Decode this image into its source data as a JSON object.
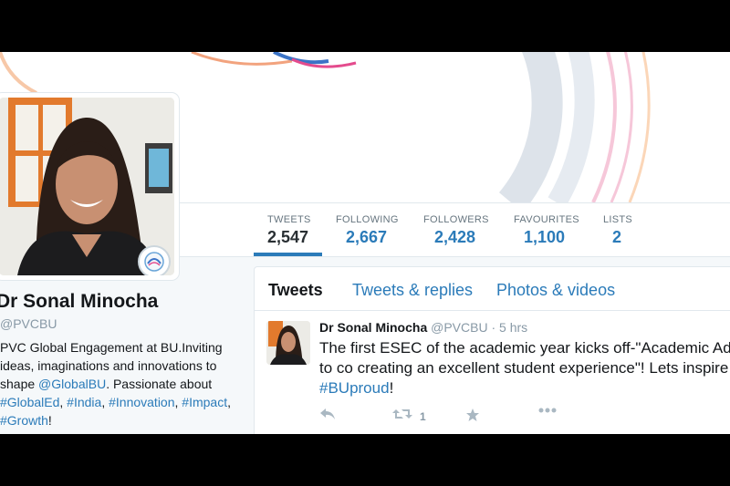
{
  "stats": [
    {
      "label": "TWEETS",
      "value": "2,547"
    },
    {
      "label": "FOLLOWING",
      "value": "2,667"
    },
    {
      "label": "FOLLOWERS",
      "value": "2,428"
    },
    {
      "label": "FAVOURITES",
      "value": "1,100"
    },
    {
      "label": "LISTS",
      "value": "2"
    }
  ],
  "profile": {
    "name": "Dr Sonal Minocha",
    "handle": "@PVCBU",
    "bio_parts": {
      "p1": "PVC Global Engagement at BU.Inviting ideas, imaginations and innovations to shape ",
      "l1": "@GlobalBU",
      "p2": ". Passionate about ",
      "l2": "#GlobalEd",
      "p3": ", ",
      "l3": "#India",
      "p4": ", ",
      "l4": "#Innovation",
      "p5": ", ",
      "l5": "#Impact",
      "p6": ", ",
      "l6": "#Growth",
      "p7": "!"
    }
  },
  "tabs": [
    "Tweets",
    "Tweets & replies",
    "Photos & videos"
  ],
  "tweet": {
    "name": "Dr Sonal Minocha",
    "meta": "@PVCBU · 5 hrs",
    "line1": "The first ESEC of the academic year kicks off-\"Academic Advis",
    "line2": "to co creating an excellent student experience\"! Lets inspire",
    "hashtag": "#BUproud",
    "after_hashtag": "!",
    "retweet_count": "1"
  },
  "colors": {
    "accent": "#2b7bb9",
    "text": "#14171a",
    "muted": "#8899a6"
  },
  "icons": {
    "reply": "reply-icon",
    "retweet": "retweet-icon",
    "favourite": "star-icon",
    "more": "more-icon"
  }
}
